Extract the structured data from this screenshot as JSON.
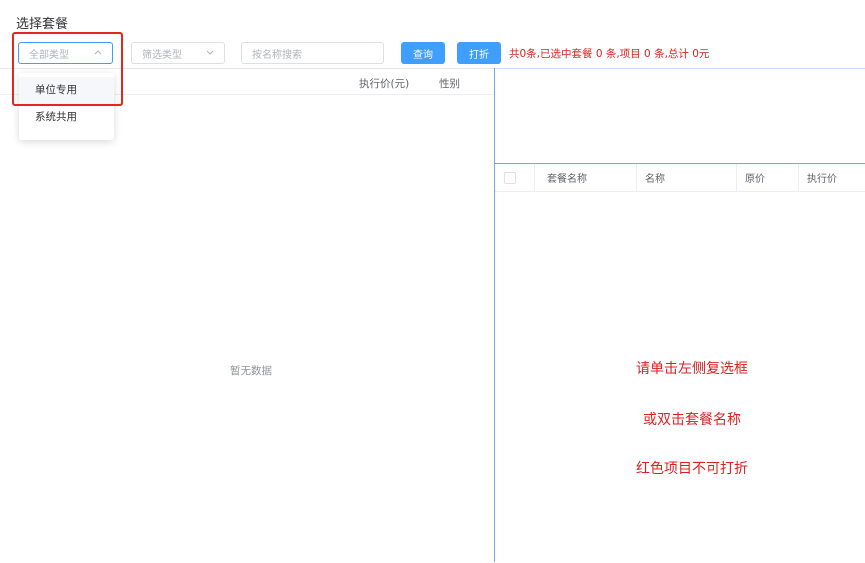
{
  "page_title": "选择套餐",
  "filters": {
    "type_select_placeholder": "全部类型",
    "screen_select_placeholder": "筛选类型",
    "search_placeholder": "按名称搜索",
    "query_button": "查询",
    "fold_button": "打折"
  },
  "summary": "共0条,已选中套餐 0 条,项目 0 条,总计 0元",
  "type_dropdown": {
    "options": [
      "单位专用",
      "系统共用"
    ]
  },
  "left_table": {
    "columns": [
      "执行价(元)",
      "性别"
    ],
    "empty_text": "暂无数据"
  },
  "right_table": {
    "columns": [
      "套餐名称",
      "名称",
      "原价",
      "执行价"
    ]
  },
  "hints": [
    "请单击左侧复选框",
    "或双击套餐名称",
    "红色项目不可打折"
  ],
  "colors": {
    "primary": "#409eff",
    "alert": "#e02020",
    "highlight_border": "#e0281e"
  }
}
